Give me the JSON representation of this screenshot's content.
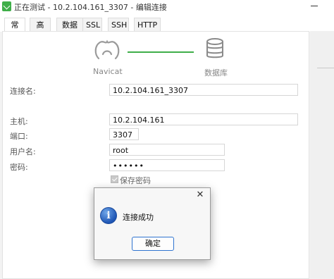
{
  "window": {
    "title": "正在测试 - 10.2.104.161_3307 - 编辑连接"
  },
  "tabs": [
    {
      "label": "常规",
      "active": true
    },
    {
      "label": "高级",
      "active": false
    },
    {
      "label": "数据库",
      "active": false
    },
    {
      "label": "SSL",
      "active": false
    },
    {
      "label": "SSH",
      "active": false
    },
    {
      "label": "HTTP",
      "active": false
    }
  ],
  "header": {
    "left_caption": "Navicat",
    "right_caption": "数据库",
    "connector_color": "#3fae49"
  },
  "form": {
    "connection_name_label": "连接名:",
    "connection_name_value": "10.2.104.161_3307",
    "host_label": "主机:",
    "host_value": "10.2.104.161",
    "port_label": "端口:",
    "port_value": "3307",
    "username_label": "用户名:",
    "username_value": "root",
    "password_label": "密码:",
    "password_value": "••••••",
    "save_password_label": "保存密码",
    "save_password_checked": true
  },
  "dialog": {
    "close_glyph": "✕",
    "icon_glyph": "i",
    "message": "连接成功",
    "ok_label": "确定"
  },
  "colors": {
    "accent": "#2f74d0",
    "success_line": "#3fae49",
    "info_icon": "#1f56b5"
  }
}
